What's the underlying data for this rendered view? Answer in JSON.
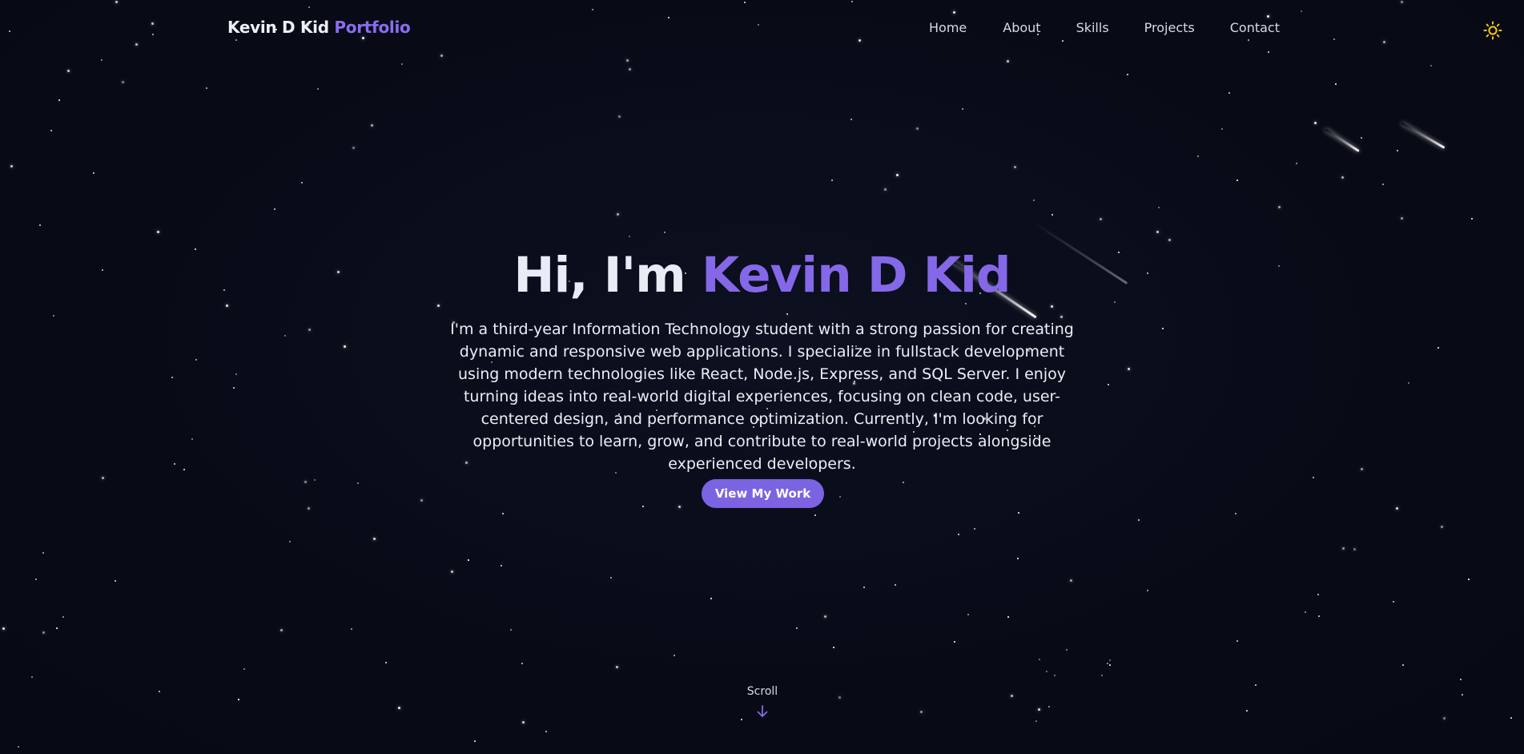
{
  "header": {
    "brand_name": "Kevin D Kid",
    "brand_accent": "Portfolio",
    "nav": [
      {
        "label": "Home"
      },
      {
        "label": "About"
      },
      {
        "label": "Skills"
      },
      {
        "label": "Projects"
      },
      {
        "label": "Contact"
      }
    ],
    "theme_toggle_icon": "sun-icon"
  },
  "hero": {
    "greeting": "Hi, I'm",
    "name": "Kevin D Kid",
    "description": "I'm a third-year Information Technology student with a strong passion for creating dynamic and responsive web applications. I specialize in fullstack development using modern technologies like React, Node.js, Express, and SQL Server. I enjoy turning ideas into real-world digital experiences, focusing on clean code, user-centered design, and performance optimization. Currently, I'm looking for opportunities to learn, grow, and contribute to real-world projects alongside experienced developers.",
    "cta_label": "View My Work"
  },
  "scroll": {
    "label": "Scroll",
    "icon": "arrow-down-icon"
  },
  "colors": {
    "background": "#080b16",
    "accent": "#8468e8",
    "button": "#7c63e2",
    "text": "#eceef5",
    "sun_icon": "#f5c518"
  },
  "background_decoration": "starfield-with-shooting-stars"
}
